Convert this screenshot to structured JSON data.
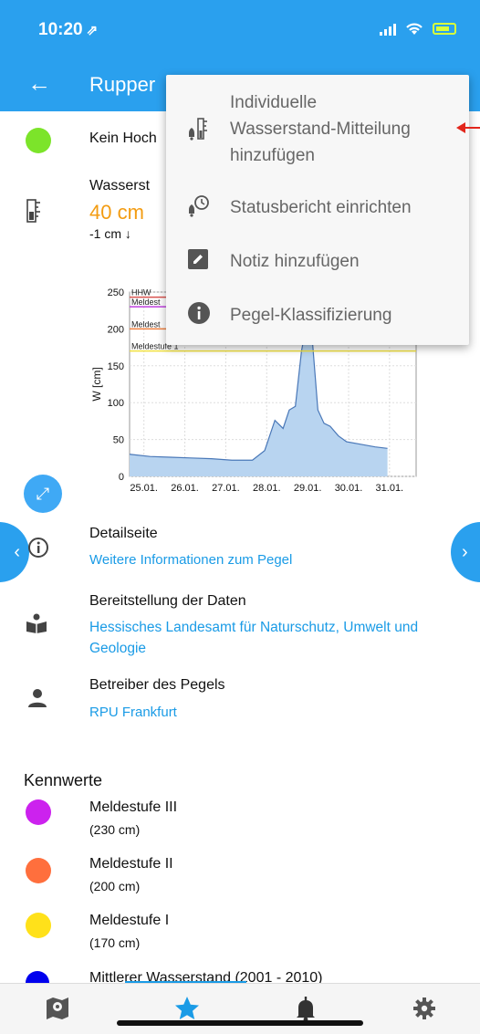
{
  "status_bar": {
    "time": "10:20",
    "location_glyph": "⇗"
  },
  "app_bar": {
    "back_glyph": "←",
    "title": "Rupper"
  },
  "alert_row": {
    "text": "Kein Hoch",
    "dot_color": "#7ce42a"
  },
  "water_level": {
    "label": "Wasserst",
    "value": "40 cm",
    "change": "-1 cm ↓",
    "value_color": "#f39c12"
  },
  "chart_data": {
    "type": "area",
    "ylabel": "W [cm]",
    "ylim": [
      0,
      250
    ],
    "yticks": [
      0,
      50,
      100,
      150,
      200,
      250
    ],
    "xticks": [
      "25.01.",
      "26.01.",
      "27.01.",
      "28.01.",
      "29.01.",
      "30.01.",
      "31.01."
    ],
    "thresholds": [
      {
        "name": "HHW",
        "value": 243,
        "color": "#d9534f"
      },
      {
        "name": "Meldest",
        "value": 230,
        "color": "#c040e0"
      },
      {
        "name": "Meldest",
        "value": 200,
        "color": "#f08040"
      },
      {
        "name": "Meldestufe 1",
        "value": 170,
        "color": "#f0e040"
      }
    ],
    "series": [
      {
        "x": [
          0.0,
          0.5,
          1.0,
          1.5,
          2.0,
          2.5,
          3.0,
          3.3,
          3.55,
          3.75,
          3.9,
          4.05,
          4.2,
          4.4,
          4.6,
          4.75,
          4.9,
          5.1,
          5.3,
          5.6,
          6.0,
          6.3
        ],
        "values": [
          30,
          27,
          26,
          25,
          24,
          22,
          22,
          35,
          76,
          65,
          90,
          95,
          170,
          230,
          90,
          72,
          68,
          55,
          47,
          44,
          40,
          38
        ]
      }
    ],
    "fill_color": "#b8d4f0",
    "line_color": "#4a78b8"
  },
  "details": {
    "title": "Detailseite",
    "link": "Weitere Informationen zum Pegel"
  },
  "provider": {
    "title": "Bereitstellung der Daten",
    "link_line1": "Hessisches Landesamt für Naturschutz, Umwelt und",
    "link_line2": "Geologie"
  },
  "operator": {
    "title": "Betreiber des Pegels",
    "link": "RPU Frankfurt"
  },
  "kennwerte": {
    "heading": "Kennwerte",
    "items": [
      {
        "name": "Meldestufe III",
        "value": "(230 cm)",
        "color": "#cc22ee"
      },
      {
        "name": "Meldestufe II",
        "value": "(200 cm)",
        "color": "#ff6f3d"
      },
      {
        "name": "Meldestufe I",
        "value": "(170 cm)",
        "color": "#ffe11a"
      },
      {
        "name": "Mittlerer Wasserstand (2001 - 2010)",
        "value": "",
        "color": "#0000ee"
      }
    ]
  },
  "menu": {
    "items": [
      {
        "line1": "Individuelle",
        "line2": "Wasserstand-Mitteilung",
        "line3": "hinzufügen",
        "icon": "bell-gauge-icon"
      },
      {
        "label": "Statusbericht einrichten",
        "icon": "bell-clock-icon"
      },
      {
        "label": "Notiz hinzufügen",
        "icon": "edit-note-icon"
      },
      {
        "label": "Pegel-Klassifizierung",
        "icon": "info-icon"
      }
    ]
  },
  "tabs": [
    {
      "name": "map",
      "icon": "map-icon"
    },
    {
      "name": "favorites",
      "icon": "star-icon",
      "active": true,
      "color": "#1a9be6"
    },
    {
      "name": "alerts",
      "icon": "bell-icon"
    },
    {
      "name": "settings",
      "icon": "gear-icon"
    }
  ]
}
